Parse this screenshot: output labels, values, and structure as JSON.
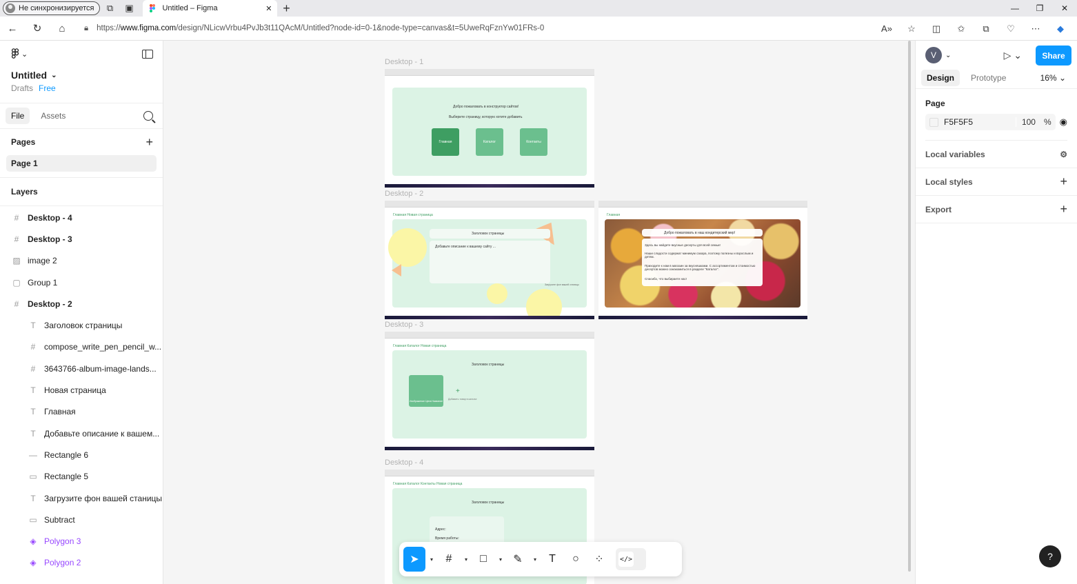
{
  "browser": {
    "profile_label": "Не синхронизируется",
    "tab_title": "Untitled – Figma",
    "url_prefix": "https://",
    "url_host": "www.figma.com",
    "url_path": "/design/NLicwVrbu4PvJb3t11QAcM/Untitled?node-id=0-1&node-type=canvas&t=5UweRqFznYw01FRs-0"
  },
  "left": {
    "file_title": "Untitled",
    "drafts": "Drafts",
    "plan": "Free",
    "tabs": [
      "File",
      "Assets"
    ],
    "pages_header": "Pages",
    "page": "Page 1",
    "layers_header": "Layers",
    "layers": [
      {
        "name": "Desktop - 4",
        "icon": "#",
        "type": "frame"
      },
      {
        "name": "Desktop - 3",
        "icon": "#",
        "type": "frame"
      },
      {
        "name": "image 2",
        "icon": "▨",
        "type": "image"
      },
      {
        "name": "Group 1",
        "icon": "▢",
        "type": "group"
      },
      {
        "name": "Desktop - 2",
        "icon": "#",
        "type": "frame"
      },
      {
        "name": "Заголовок страницы",
        "icon": "T",
        "type": "text"
      },
      {
        "name": "compose_write_pen_pencil_w...",
        "icon": "#",
        "type": "frame"
      },
      {
        "name": "3643766-album-image-lands...",
        "icon": "#",
        "type": "frame"
      },
      {
        "name": "Новая страница",
        "icon": "T",
        "type": "text"
      },
      {
        "name": "Главная",
        "icon": "T",
        "type": "text"
      },
      {
        "name": "Добавьте описание к вашем...",
        "icon": "T",
        "type": "text"
      },
      {
        "name": "Rectangle 6",
        "icon": "—",
        "type": "line"
      },
      {
        "name": "Rectangle 5",
        "icon": "▭",
        "type": "rect"
      },
      {
        "name": "Загрузите фон вашей станицы",
        "icon": "T",
        "type": "text"
      },
      {
        "name": "Subtract",
        "icon": "▭",
        "type": "rect"
      },
      {
        "name": "Polygon 3",
        "icon": "◈",
        "type": "component"
      },
      {
        "name": "Polygon 2",
        "icon": "◈",
        "type": "component"
      }
    ]
  },
  "canvas": {
    "frames": {
      "d1": {
        "label": "Desktop - 1",
        "welcome": "Добро пожаловать в конструктор сайтов!",
        "choose": "Выберите страницу, которую хотите добавить",
        "btn_main": "Главная",
        "btn_catalog": "Каталог",
        "btn_contacts": "Контакты"
      },
      "d2": {
        "label": "Desktop - 2",
        "nav": "Главная   Новая страница",
        "heading": "Заголовок страницы",
        "desc": "Добавьте описание к вашему сайту ...",
        "upload": "Загрузите фон вашей станицы"
      },
      "d2b": {
        "nav": "Главная",
        "welcome": "Добро пожаловать в наш кондитерский мир!",
        "p1": "Здесь вы найдете вкусные десерты для всей семьи!",
        "p2": "Наши сладости содержат минимум сахара, поэтому полезны и взрослым и детям.",
        "p3": "Приходите к нам в магазин за вкусняшками. С ассортиментом и стоимостью десертов можно ознакомиться в разделе \"Каталог\".",
        "p4": "Спасибо, что выбираете нас!"
      },
      "d3": {
        "label": "Desktop - 3",
        "nav": "Главная   Каталог   Новая страница",
        "heading": "Заголовок страницы",
        "card_text": "Изображение   Цена   Название",
        "add": "Добавить товар в каталог"
      },
      "d4": {
        "label": "Desktop - 4",
        "nav": "Главная   Каталог   Контакты   Новая страница",
        "heading": "Заголовок страницы",
        "address": "Адрес:",
        "hours": "Время работы:"
      }
    }
  },
  "right": {
    "avatar": "V",
    "share": "Share",
    "tabs": [
      "Design",
      "Prototype"
    ],
    "zoom": "16%",
    "page_header": "Page",
    "bg_color": "F5F5F5",
    "opacity": "100",
    "opacity_unit": "%",
    "local_variables": "Local variables",
    "local_styles": "Local styles",
    "export": "Export"
  },
  "help": "?",
  "colors": {
    "accent": "#0d99ff",
    "mint": "#dcf3e5",
    "green": "#6bbf8e",
    "component": "#9747ff"
  }
}
